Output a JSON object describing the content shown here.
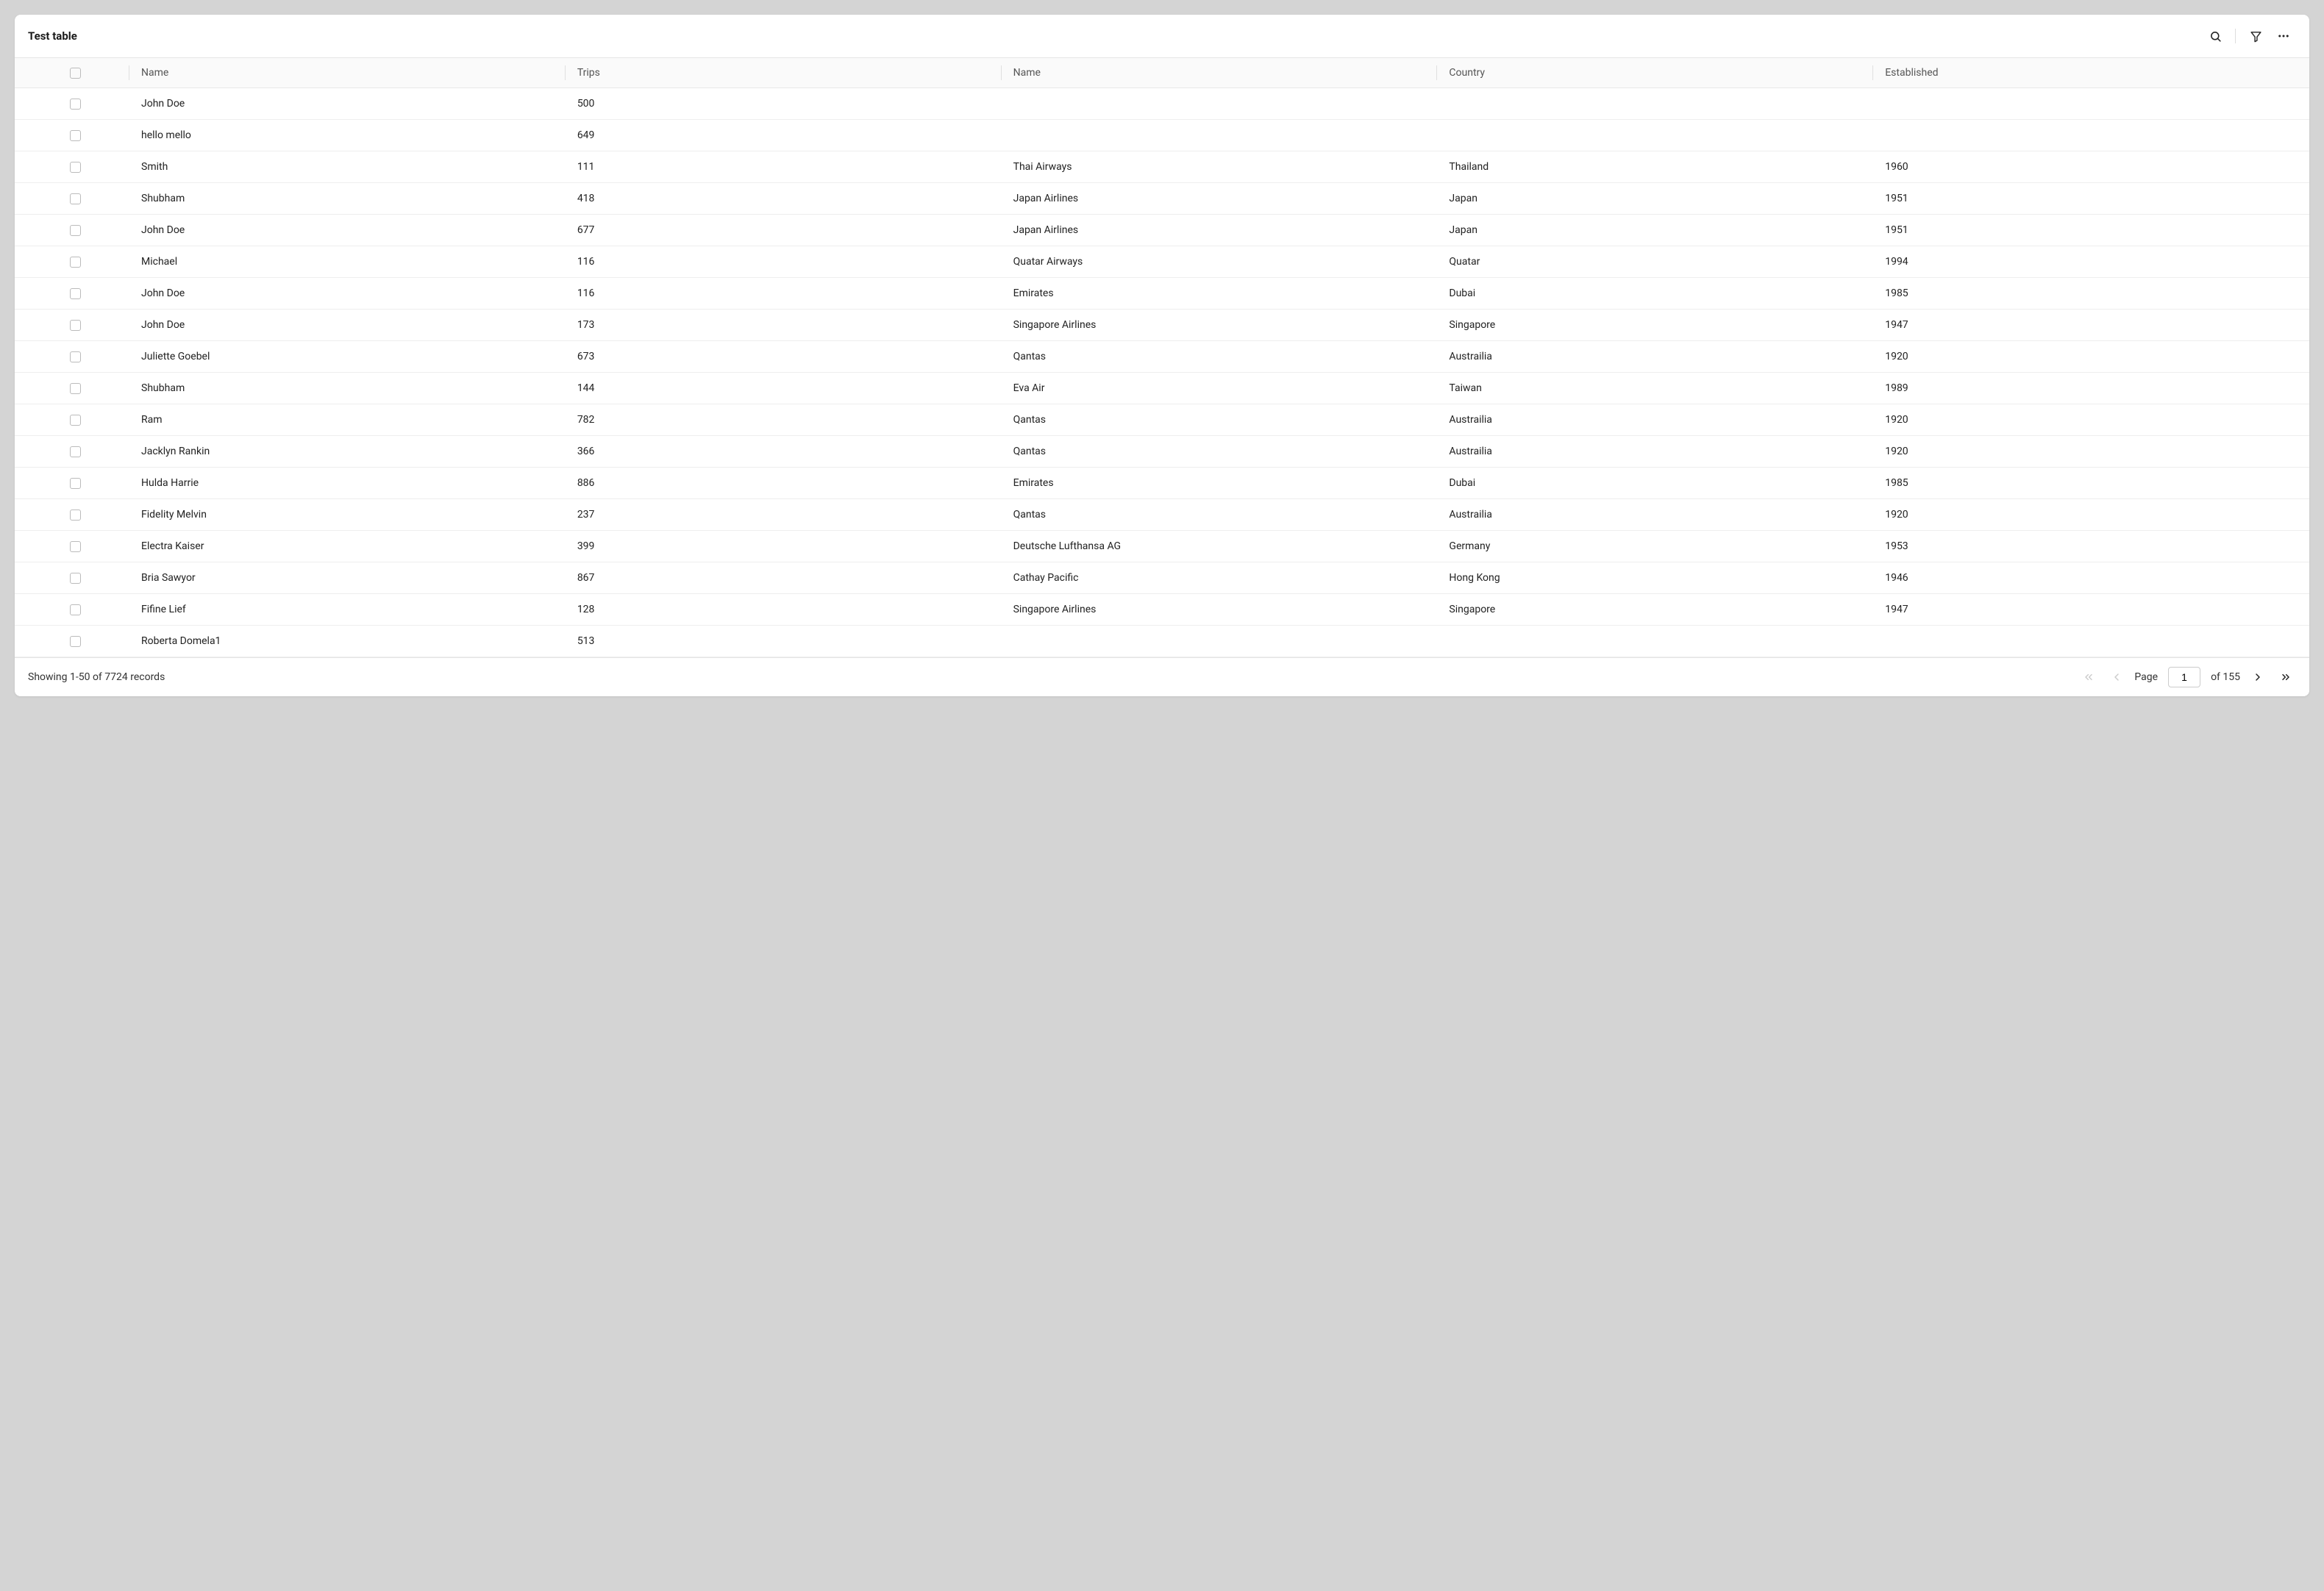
{
  "title": "Test table",
  "columns": {
    "name1": "Name",
    "trips": "Trips",
    "name2": "Name",
    "country": "Country",
    "established": "Established"
  },
  "rows": [
    {
      "name1": "John Doe",
      "trips": "500",
      "name2": "",
      "country": "",
      "established": ""
    },
    {
      "name1": "hello mello",
      "trips": "649",
      "name2": "",
      "country": "",
      "established": ""
    },
    {
      "name1": "Smith",
      "trips": "111",
      "name2": "Thai Airways",
      "country": "Thailand",
      "established": "1960"
    },
    {
      "name1": "Shubham",
      "trips": "418",
      "name2": "Japan Airlines",
      "country": "Japan",
      "established": "1951"
    },
    {
      "name1": "John Doe",
      "trips": "677",
      "name2": "Japan Airlines",
      "country": "Japan",
      "established": "1951"
    },
    {
      "name1": "Michael",
      "trips": "116",
      "name2": "Quatar Airways",
      "country": "Quatar",
      "established": "1994"
    },
    {
      "name1": "John Doe",
      "trips": "116",
      "name2": "Emirates",
      "country": "Dubai",
      "established": "1985"
    },
    {
      "name1": "John Doe",
      "trips": "173",
      "name2": "Singapore Airlines",
      "country": "Singapore",
      "established": "1947"
    },
    {
      "name1": "Juliette Goebel",
      "trips": "673",
      "name2": "Qantas",
      "country": "Austrailia",
      "established": "1920"
    },
    {
      "name1": "Shubham",
      "trips": "144",
      "name2": "Eva Air",
      "country": "Taiwan",
      "established": "1989"
    },
    {
      "name1": "Ram",
      "trips": "782",
      "name2": "Qantas",
      "country": "Austrailia",
      "established": "1920"
    },
    {
      "name1": "Jacklyn Rankin",
      "trips": "366",
      "name2": "Qantas",
      "country": "Austrailia",
      "established": "1920"
    },
    {
      "name1": "Hulda Harrie",
      "trips": "886",
      "name2": "Emirates",
      "country": "Dubai",
      "established": "1985"
    },
    {
      "name1": "Fidelity Melvin",
      "trips": "237",
      "name2": "Qantas",
      "country": "Austrailia",
      "established": "1920"
    },
    {
      "name1": "Electra Kaiser",
      "trips": "399",
      "name2": "Deutsche Lufthansa AG",
      "country": "Germany",
      "established": "1953"
    },
    {
      "name1": "Bria Sawyor",
      "trips": "867",
      "name2": "Cathay Pacific",
      "country": "Hong Kong",
      "established": "1946"
    },
    {
      "name1": "Fifine Lief",
      "trips": "128",
      "name2": "Singapore Airlines",
      "country": "Singapore",
      "established": "1947"
    },
    {
      "name1": "Roberta Domela1",
      "trips": "513",
      "name2": "",
      "country": "",
      "established": ""
    }
  ],
  "footer": {
    "status": "Showing 1-50 of 7724 records",
    "page_label": "Page",
    "page_input": "1",
    "of_label": "of 155"
  }
}
